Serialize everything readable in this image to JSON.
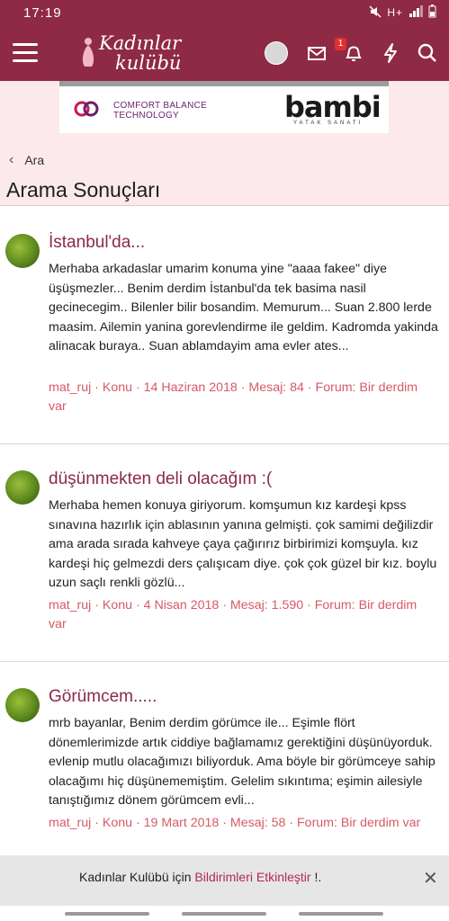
{
  "status_bar": {
    "time": "17:19",
    "network": "H+"
  },
  "header": {
    "logo_line1": "Kadınlar",
    "logo_line2": "kulübü",
    "notification_count": "1"
  },
  "ad": {
    "brand1_line1": "COMFORT BALANCE",
    "brand1_line2": "TECHNOLOGY",
    "brand2": "bambi",
    "brand2_sub": "YATAK SANATI"
  },
  "breadcrumb": {
    "label": "Ara"
  },
  "page": {
    "title": "Arama Sonuçları"
  },
  "results": [
    {
      "title": "İstanbul'da...",
      "snippet": "Merhaba arkadaslar umarim konuma yine \"aaaa fakee\" diye üşüşmezler... Benim derdim İstanbul'da tek basima nasil gecinecegim.. Bilenler bilir bosandim. Memurum... Suan 2.800 lerde maasim. Ailemin yanina gorevlendirme ile geldim. Kadromda yakinda alinacak buraya.. Suan ablamdayim ama evler ates...",
      "author": "mat_ruj",
      "type": "Konu",
      "date": "14 Haziran 2018",
      "replies": "Mesaj: 84",
      "forum": "Forum: Bir derdim var"
    },
    {
      "title": "düşünmekten deli olacağım :(",
      "snippet": "Merhaba hemen konuya giriyorum. komşumun kız kardeşi kpss sınavına hazırlık için ablasının yanına gelmişti. çok samimi değilizdir ama arada sırada kahveye çaya çağırırız birbirimizi komşuyla. kız kardeşi hiç gelmezdi ders çalışıcam diye. çok çok güzel bir kız. boylu uzun saçlı renkli gözlü...",
      "author": "mat_ruj",
      "type": "Konu",
      "date": "4 Nisan 2018",
      "replies": "Mesaj: 1.590",
      "forum": "Forum: Bir derdim var"
    },
    {
      "title": "Görümcem.....",
      "snippet": "mrb bayanlar, Benim derdim görümce ile... Eşimle flört dönemlerimizde artık ciddiye bağlamamız gerektiğini düşünüyorduk. evlenip mutlu olacağımızı biliyorduk. Ama böyle bir görümceye sahip olacağımı hiç düşünememiştim. Gelelim sıkıntıma; eşimin ailesiyle tanıştığımız dönem görümcem evli...",
      "author": "mat_ruj",
      "type": "Konu",
      "date": "19 Mart 2018",
      "replies": "Mesaj: 58",
      "forum": "Forum: Bir derdim var"
    }
  ],
  "notification_bar": {
    "prefix": "Kadınlar Kulübü için ",
    "link": "Bildirimleri Etkinleştir",
    "suffix": " !."
  },
  "colors": {
    "brand": "#8f2a44",
    "link": "#8a2a47",
    "meta": "#d65a64"
  }
}
